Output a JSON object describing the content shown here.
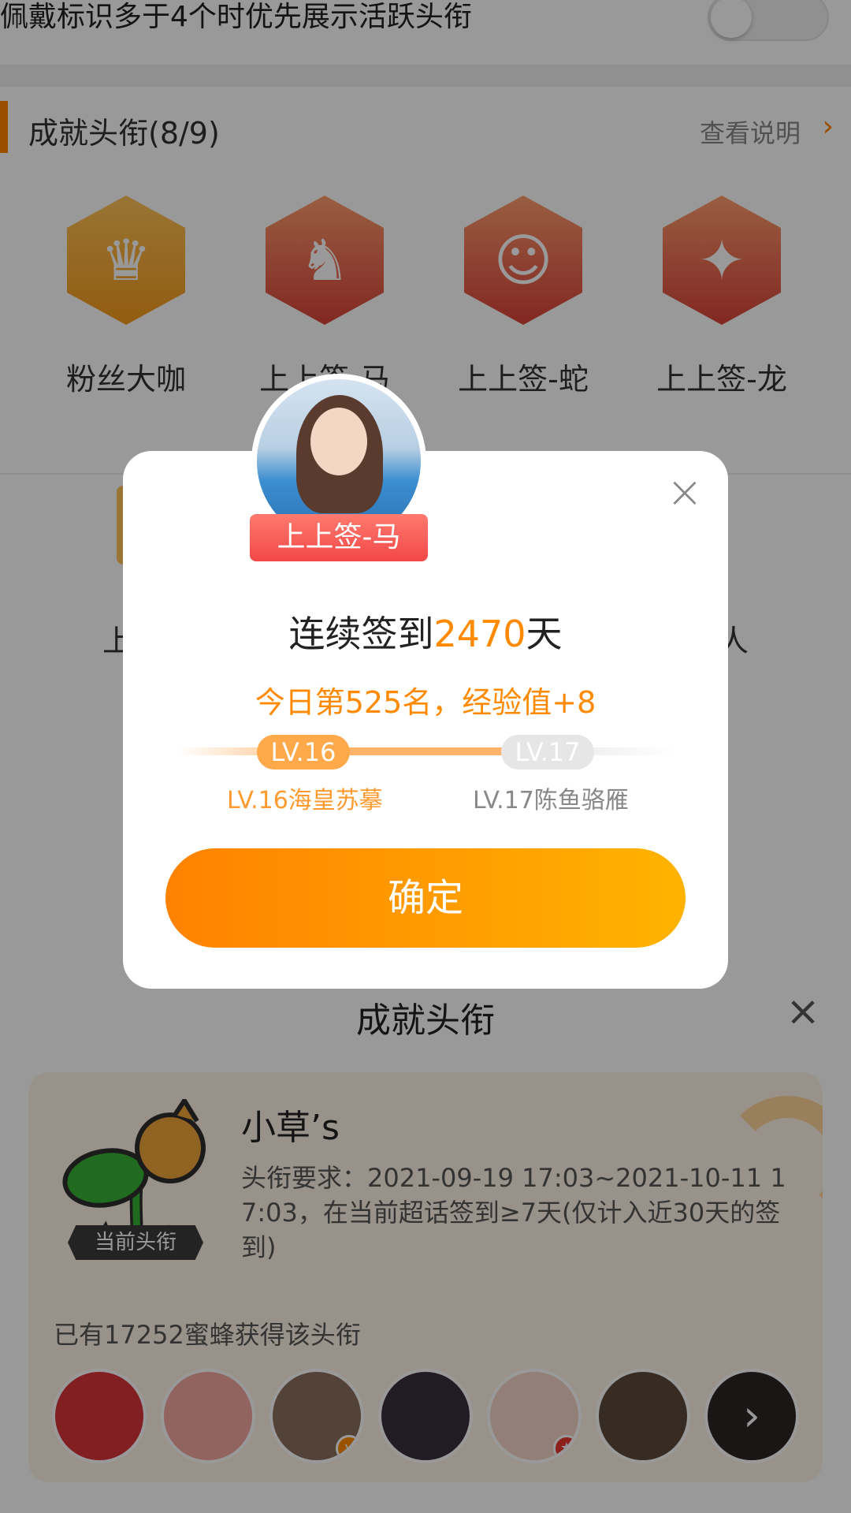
{
  "background": {
    "top_setting_text": "佩戴标识多于4个时优先展示活跃头衔",
    "section": {
      "title": "成就头衔(8/9)",
      "link": "查看说明"
    },
    "badges": [
      {
        "label": "粉丝大咖",
        "icon": "crown-icon"
      },
      {
        "label": "上上签-马",
        "icon": "horse-icon"
      },
      {
        "label": "上上签-蛇",
        "icon": "snake-icon"
      },
      {
        "label": "上上签-龙",
        "icon": "dragon-icon"
      }
    ],
    "row2_partial": [
      "上",
      "人"
    ]
  },
  "sheet": {
    "title": "成就头衔",
    "current_tag": "当前头衔",
    "title_name": "小草’s",
    "requirement": "头衔要求：2021-09-19 17:03~2021-10-11 17:03，在当前超话签到≥7天(仅计入近30天的签到)",
    "owners_text": "已有17252蜜蜂获得该头衔",
    "avatars": [
      {
        "color": "#d8343a",
        "badge": ""
      },
      {
        "color": "#f2a7a0",
        "badge": ""
      },
      {
        "color": "#8a6f5c",
        "badge": "v"
      },
      {
        "color": "#3a2f3f",
        "badge": ""
      },
      {
        "color": "#f3d4c6",
        "badge": "★"
      },
      {
        "color": "#5c4a3c",
        "badge": ""
      },
      {
        "color": "#2c2625",
        "badge": "arrow"
      }
    ]
  },
  "modal": {
    "ribbon": "上上签-马",
    "streak_prefix": "连续签到",
    "streak_days": "2470",
    "streak_suffix": "天",
    "today_text": "今日第525名，经验值+8",
    "level_current": "LV.16",
    "level_next": "LV.17",
    "level_current_name": "LV.16海皇苏摹",
    "level_next_name": "LV.17陈鱼骆雁",
    "level_progress": 0.62,
    "confirm_label": "确定"
  },
  "colors": {
    "accent": "#ff8200",
    "accent_light": "#ffb300",
    "ribbon": "#f24848"
  }
}
